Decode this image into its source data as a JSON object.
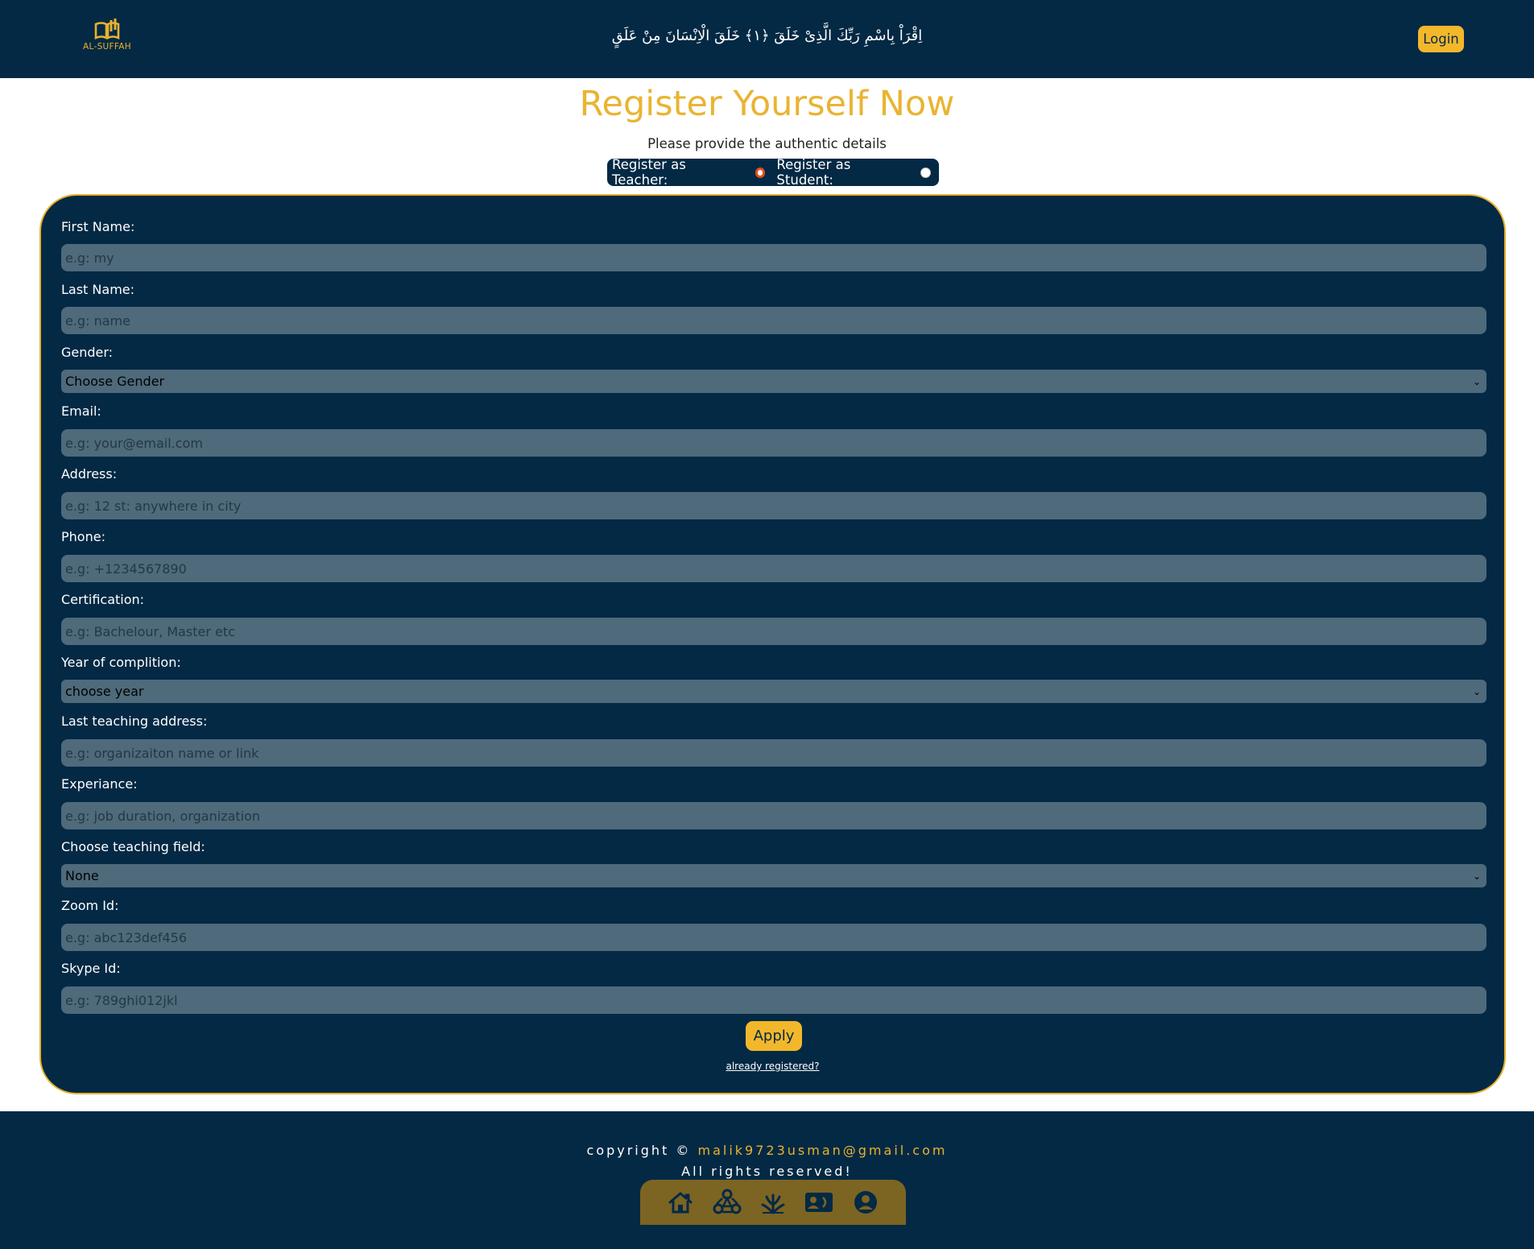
{
  "header": {
    "logo_text": "AL-SUFFAH",
    "verse": "اِقْرَاْ بِاسْمِ رَبِّكَ الَّذِیْ خَلَقَ ﴿۱﴾ خَلَقَ الْاِنْسَانَ مِنْ عَلَقٍ",
    "login_label": "Login"
  },
  "page": {
    "title": "Register Yourself Now",
    "subtitle": "Please provide the authentic details"
  },
  "role": {
    "teacher_label": "Register as Teacher:",
    "student_label": "Register as Student:",
    "selected": "teacher"
  },
  "form": {
    "first_name": {
      "label": "First Name:",
      "placeholder": "e.g: my"
    },
    "last_name": {
      "label": "Last Name:",
      "placeholder": "e.g: name"
    },
    "gender": {
      "label": "Gender:",
      "value": "Choose Gender"
    },
    "email": {
      "label": "Email:",
      "placeholder": "e.g: your@email.com"
    },
    "address": {
      "label": "Address:",
      "placeholder": "e.g: 12 st: anywhere in city"
    },
    "phone": {
      "label": "Phone:",
      "placeholder": "e.g: +1234567890"
    },
    "certification": {
      "label": "Certification:",
      "placeholder": "e.g: Bachelour, Master etc"
    },
    "year": {
      "label": "Year of complition:",
      "value": "choose year"
    },
    "last_teaching": {
      "label": "Last teaching address:",
      "placeholder": "e.g: organizaiton name or link"
    },
    "experience": {
      "label": "Experiance:",
      "placeholder": "e.g: job duration, organization"
    },
    "teaching_field": {
      "label": "Choose teaching field:",
      "value": "None"
    },
    "zoom": {
      "label": "Zoom Id:",
      "placeholder": "e.g: abc123def456"
    },
    "skype": {
      "label": "Skype Id:",
      "placeholder": "e.g: 789ghi012jkl"
    },
    "apply_label": "Apply",
    "already_label": "already registered?"
  },
  "footer": {
    "copyright_prefix": "copyright © ",
    "email": "malik9723usman@gmail.com",
    "rights": "All rights reserved!",
    "nav_icons": [
      "home-icon",
      "community-icon",
      "growth-icon",
      "contact-card-icon",
      "profile-icon"
    ]
  },
  "colors": {
    "navy": "#032944",
    "gold": "#e8b22e",
    "input_bg": "#4e6a7b"
  }
}
